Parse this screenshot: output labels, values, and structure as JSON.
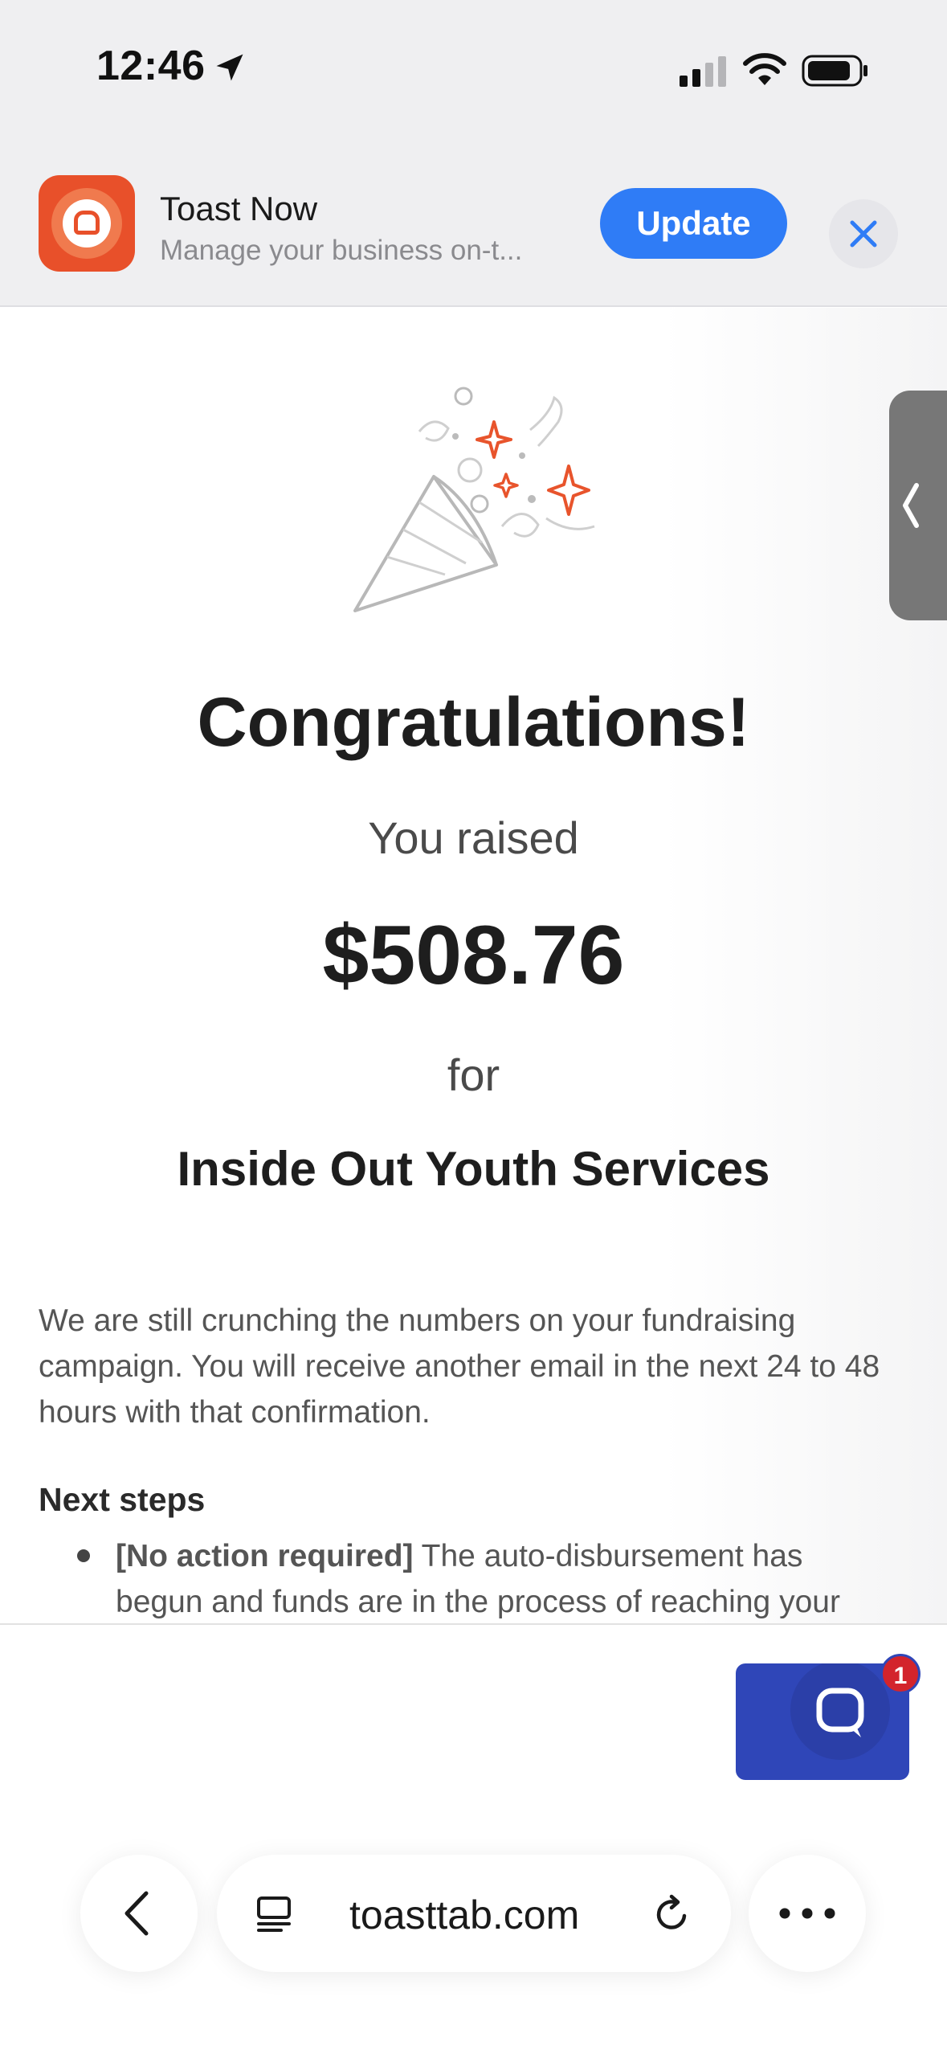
{
  "status_bar": {
    "time": "12:46",
    "icons": [
      "location-arrow-icon",
      "cellular-signal-icon",
      "wifi-icon",
      "battery-icon"
    ]
  },
  "app_banner": {
    "app_name": "Toast Now",
    "subtitle": "Manage your business on-t...",
    "update_label": "Update",
    "close_icon": "close-icon",
    "accent_color": "#2f7cf6",
    "icon_color": "#e8502a"
  },
  "content": {
    "title": "Congratulations!",
    "raised_label": "You raised",
    "amount": "$508.76",
    "for_label": "for",
    "organization": "Inside Out Youth Services",
    "message": "We are still crunching the numbers on your fundraising campaign. You will receive another email in the next 24 to 48 hours with that confirmation.",
    "next_steps_heading": "Next steps",
    "steps": [
      {
        "tag": "[No action required]",
        "text": " The auto-disbursement has begun and funds are in the process of reaching your"
      }
    ]
  },
  "chat": {
    "badge_count": "1",
    "button_color": "#2f46b8"
  },
  "browser": {
    "url": "toasttab.com",
    "icons": [
      "back-chevron-icon",
      "tab-overview-icon",
      "reload-icon",
      "more-icon"
    ]
  }
}
